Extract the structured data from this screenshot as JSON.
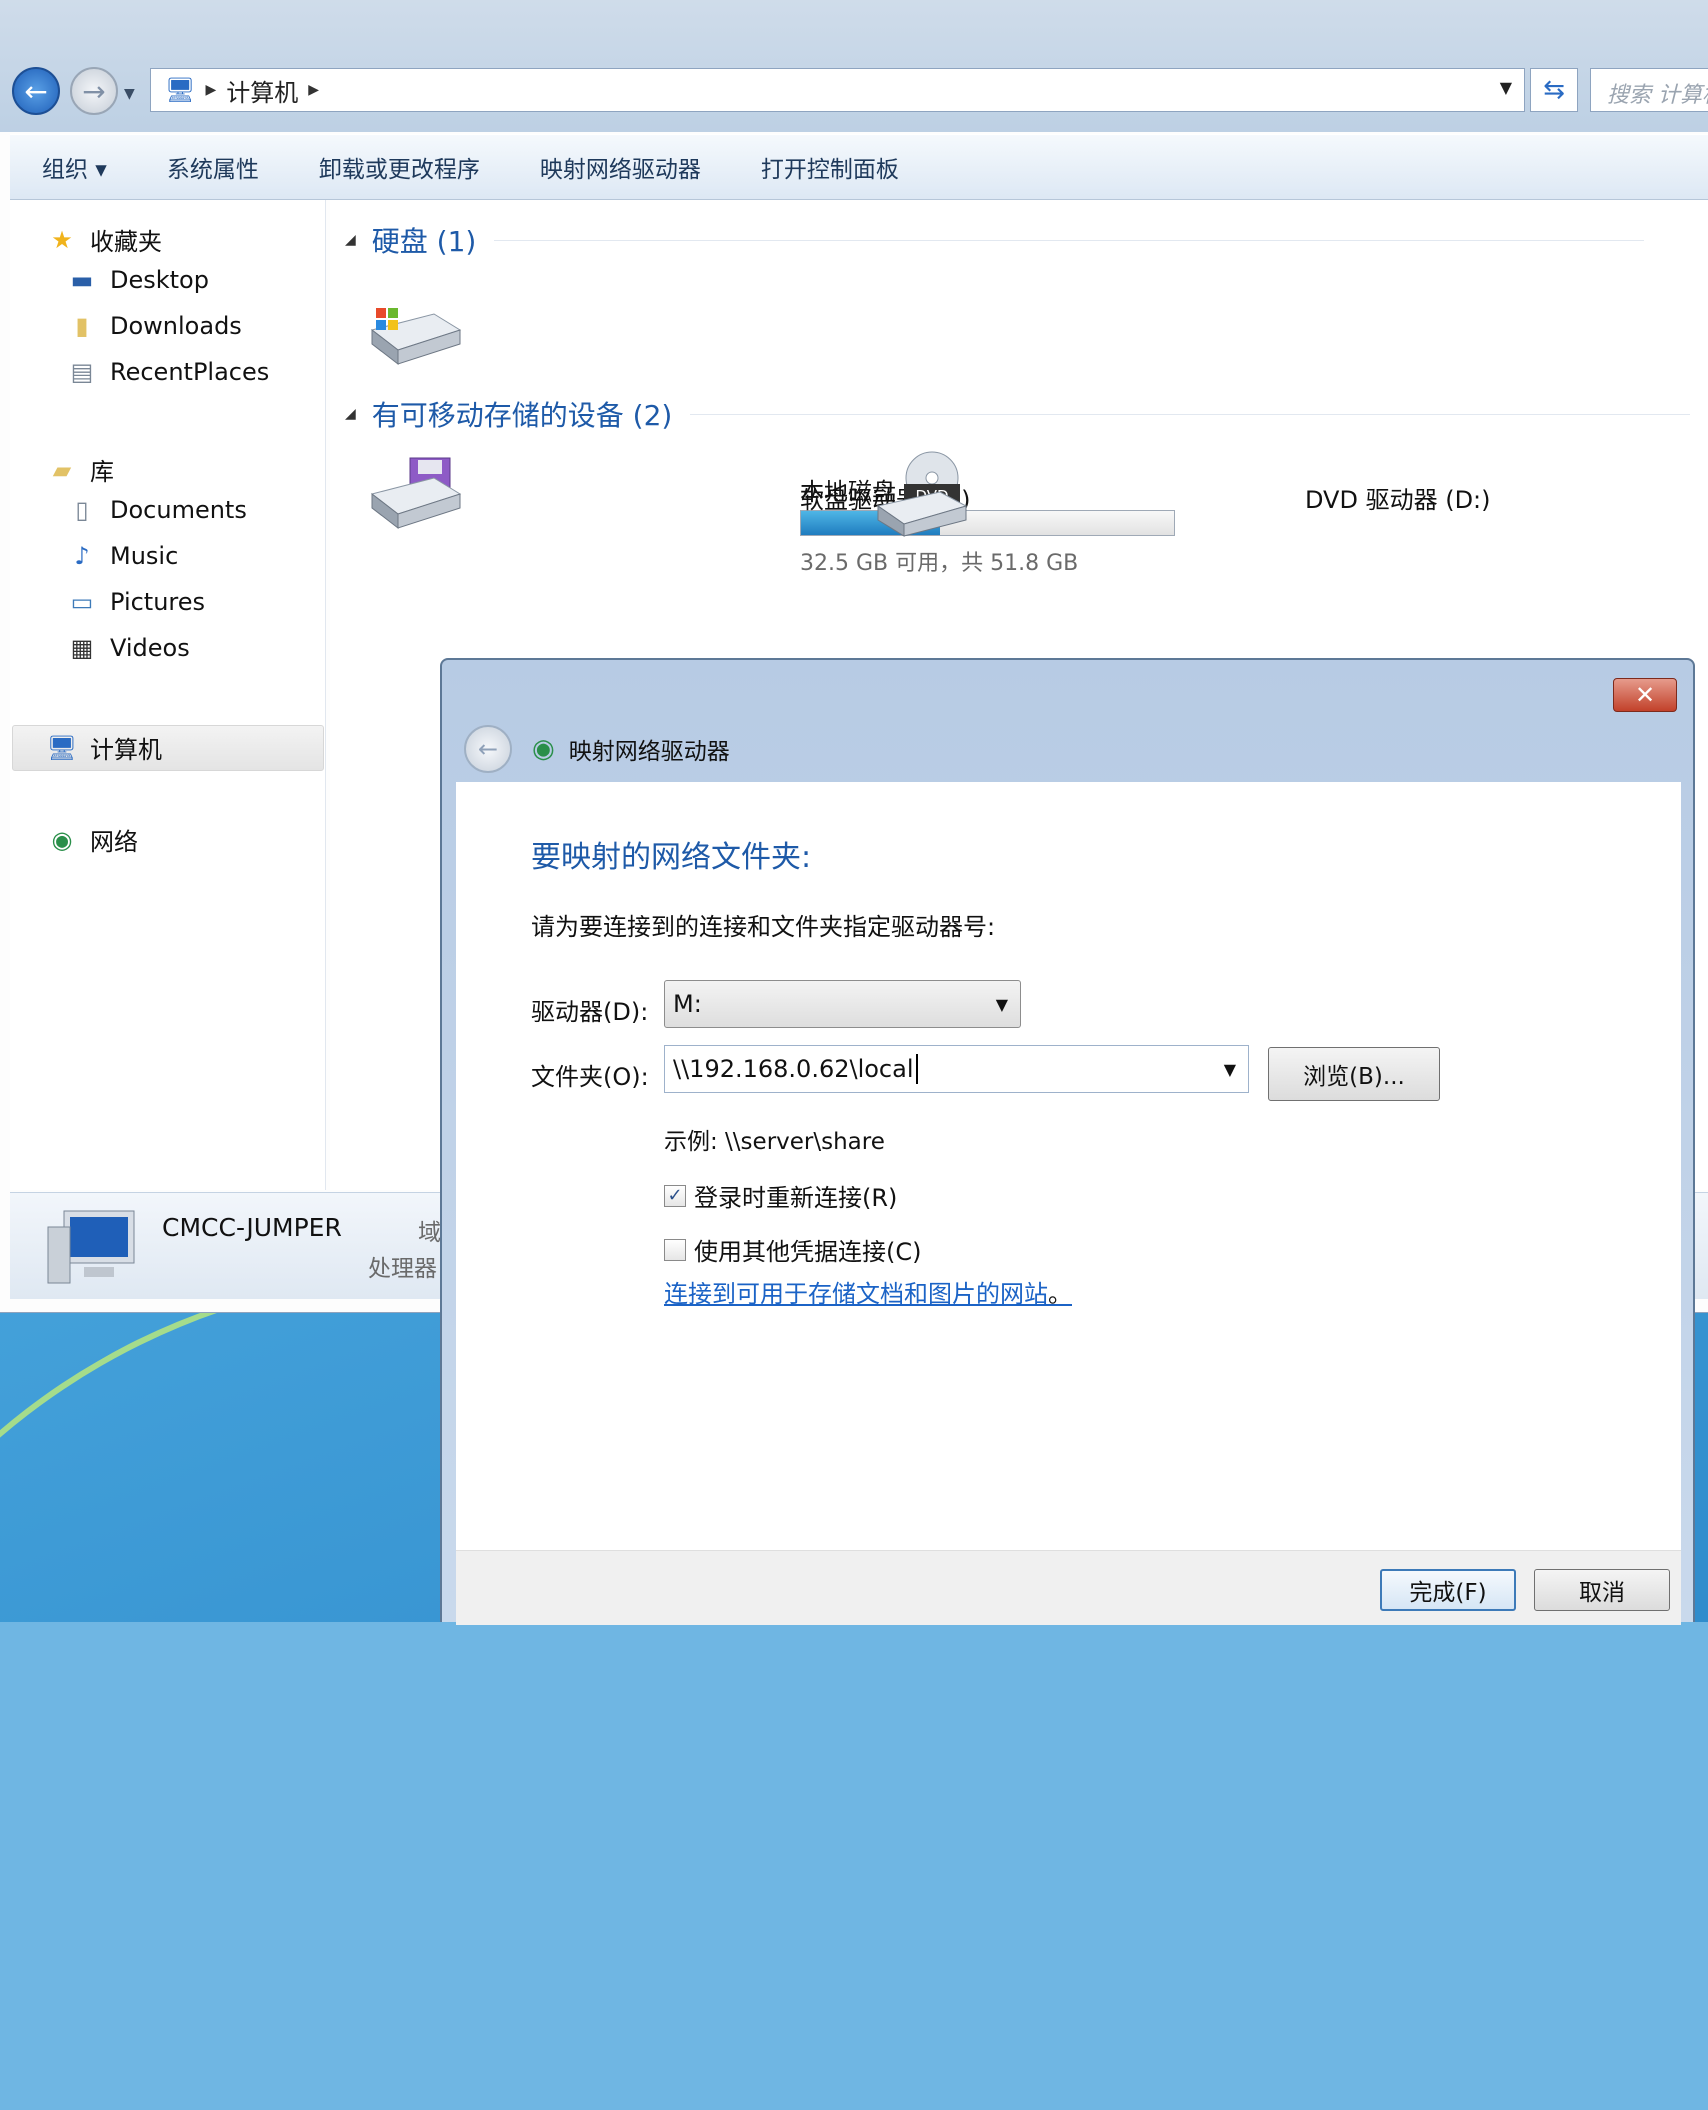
{
  "explorer": {
    "address": {
      "icon": "computer-icon",
      "segments": [
        "计算机"
      ]
    },
    "search_placeholder": "搜索 计算机",
    "commandbar": [
      "组织 ▾",
      "系统属性",
      "卸载或更改程序",
      "映射网络驱动器",
      "打开控制面板"
    ],
    "nav": {
      "favorites": {
        "label": "收藏夹",
        "items": [
          "Desktop",
          "Downloads",
          "RecentPlaces"
        ]
      },
      "libraries": {
        "label": "库",
        "items": [
          "Documents",
          "Music",
          "Pictures",
          "Videos"
        ]
      },
      "computer": "计算机",
      "network": "网络"
    },
    "groups": {
      "hdd": {
        "title": "硬盘 (1)"
      },
      "removable": {
        "title": "有可移动存储的设备 (2)"
      }
    },
    "drives": {
      "c": {
        "name": "本地磁盘 (C:)",
        "free_text": "32.5 GB 可用，共 51.8 GB",
        "used_fraction": 0.373
      },
      "a": {
        "name": "软盘驱动器 (A:)"
      },
      "d": {
        "name": "DVD 驱动器 (D:)"
      }
    },
    "details": {
      "computer_name": "CMCC-JUMPER",
      "domain_label": "域",
      "processor_label": "处理器"
    }
  },
  "dialog": {
    "title": "映射网络驱动器",
    "heading": "要映射的网络文件夹:",
    "instruction": "请为要连接到的连接和文件夹指定驱动器号:",
    "drive_label": "驱动器(D):",
    "drive_value": "M:",
    "folder_label": "文件夹(O):",
    "folder_value": "\\\\192.168.0.62\\local",
    "browse_label": "浏览(B)...",
    "example": "示例: \\\\server\\share",
    "reconnect_label": "登录时重新连接(R)",
    "reconnect_checked": true,
    "other_creds_label": "使用其他凭据连接(C)",
    "other_creds_checked": false,
    "link_text": "连接到可用于存储文档和图片的网站",
    "link_suffix": "。",
    "finish_label": "完成(F)",
    "cancel_label": "取消",
    "close_glyph": "✕"
  }
}
